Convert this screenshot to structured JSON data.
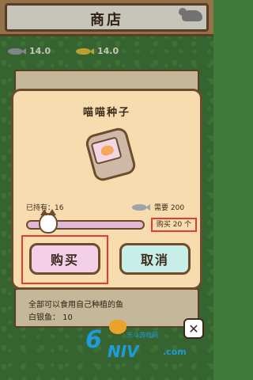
{
  "header": {
    "title": "商店"
  },
  "currencies": [
    {
      "name": "gray-fish",
      "value": "14.0",
      "color": "#9ea3a8"
    },
    {
      "name": "gold-fish",
      "value": "14.0",
      "color": "#e6c33a"
    }
  ],
  "modal": {
    "title": "喵喵种子",
    "owned_label": "已持有：16",
    "cost_label": "需要 200",
    "quantity_label": "购买 20 个",
    "buy_button": "购买",
    "cancel_button": "取消"
  },
  "background_list": {
    "line1": "全部可以食用自己种植的鱼",
    "line2": "白银鱼： 10"
  },
  "watermark": {
    "top_text": "乐斗游戏网",
    "main_text": "NIV",
    "suffix": ".com",
    "number": "6"
  },
  "colors": {
    "accent": "#e53a2f",
    "buy": "#f3d0e8",
    "cancel": "#c7efe7",
    "panel": "#f6dcae"
  }
}
